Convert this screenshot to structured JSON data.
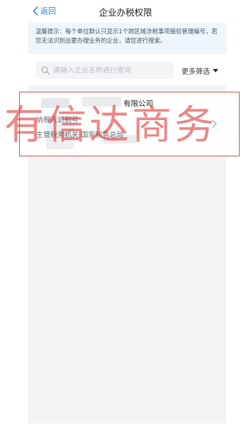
{
  "header": {
    "back_label": "返回",
    "title": "企业办税权限"
  },
  "notice": {
    "text": "温馨提示：每个单位默认只显示1个跨区域涉税事项报验管理编号，若您无法识别出要办理业务的企业，请您进行搜索。"
  },
  "search": {
    "placeholder": "请输入企业名称进行查询",
    "value": ""
  },
  "filter": {
    "label": "更多筛选"
  },
  "result": {
    "company_name": "有限公司",
    "taxpayer_id_label": "纳税人识别号",
    "authority_label": "主管税务机关:国家税务总局"
  },
  "watermark": {
    "text": "有信达商务"
  },
  "colors": {
    "accent": "#2f7de1",
    "notice_bg": "#eef5fd",
    "card_border": "#d9534f",
    "watermark": "#e23c3c"
  },
  "icons": {
    "back": "chevron-left-icon",
    "search": "search-icon",
    "filter": "caret-down-icon",
    "open": "chevron-right-icon"
  }
}
